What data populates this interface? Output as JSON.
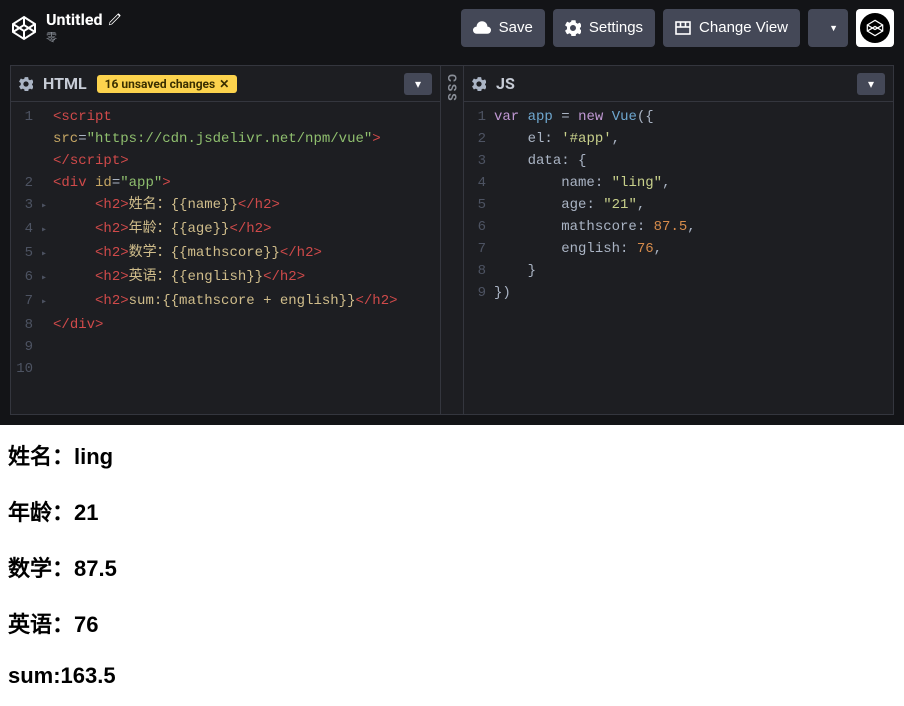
{
  "header": {
    "title": "Untitled",
    "author": "零",
    "save": "Save",
    "settings": "Settings",
    "change_view": "Change View"
  },
  "panes": {
    "html_title": "HTML",
    "js_title": "JS",
    "css_title": "CSS",
    "badge_text": "16 unsaved changes"
  },
  "html_code": [
    {
      "n": "1",
      "fold": "",
      "tokens": [
        [
          "<",
          "tag"
        ],
        [
          "script",
          "tag"
        ]
      ]
    },
    {
      "n": "",
      "fold": "",
      "tokens": [
        [
          "src",
          "attr"
        ],
        [
          "=",
          "op"
        ],
        [
          "\"https://cdn.jsdelivr.net/npm/vue\"",
          "str"
        ],
        [
          ">",
          "tag"
        ]
      ]
    },
    {
      "n": "",
      "fold": "",
      "tokens": [
        [
          "</",
          "tag"
        ],
        [
          "script",
          "tag"
        ],
        [
          ">",
          "tag"
        ]
      ]
    },
    {
      "n": "2",
      "fold": "",
      "tokens": [
        [
          "<",
          "tag"
        ],
        [
          "div ",
          "tag"
        ],
        [
          "id",
          "attr"
        ],
        [
          "=",
          "op"
        ],
        [
          "\"app\"",
          "str"
        ],
        [
          ">",
          "tag"
        ]
      ]
    },
    {
      "n": "3",
      "fold": "▸",
      "tokens": [
        [
          "     ",
          ""
        ],
        [
          "<",
          "tag"
        ],
        [
          "h2",
          "tag"
        ],
        [
          ">",
          "tag"
        ],
        [
          "姓名：{{name}}",
          "txt"
        ],
        [
          "</",
          "tag"
        ],
        [
          "h2",
          "tag"
        ],
        [
          ">",
          "tag"
        ]
      ]
    },
    {
      "n": "4",
      "fold": "▸",
      "tokens": [
        [
          "     ",
          ""
        ],
        [
          "<",
          "tag"
        ],
        [
          "h2",
          "tag"
        ],
        [
          ">",
          "tag"
        ],
        [
          "年龄：{{age}}",
          "txt"
        ],
        [
          "</",
          "tag"
        ],
        [
          "h2",
          "tag"
        ],
        [
          ">",
          "tag"
        ]
      ]
    },
    {
      "n": "5",
      "fold": "▸",
      "tokens": [
        [
          "     ",
          ""
        ],
        [
          "<",
          "tag"
        ],
        [
          "h2",
          "tag"
        ],
        [
          ">",
          "tag"
        ],
        [
          "数学：{{mathscore}}",
          "txt"
        ],
        [
          "</",
          "tag"
        ],
        [
          "h2",
          "tag"
        ],
        [
          ">",
          "tag"
        ]
      ]
    },
    {
      "n": "6",
      "fold": "▸",
      "tokens": [
        [
          "     ",
          ""
        ],
        [
          "<",
          "tag"
        ],
        [
          "h2",
          "tag"
        ],
        [
          ">",
          "tag"
        ],
        [
          "英语：{{english}}",
          "txt"
        ],
        [
          "</",
          "tag"
        ],
        [
          "h2",
          "tag"
        ],
        [
          ">",
          "tag"
        ]
      ]
    },
    {
      "n": "7",
      "fold": "▸",
      "tokens": [
        [
          "     ",
          ""
        ],
        [
          "<",
          "tag"
        ],
        [
          "h2",
          "tag"
        ],
        [
          ">",
          "tag"
        ],
        [
          "sum:{{mathscore + english}}",
          "txt"
        ],
        [
          "</",
          "tag"
        ],
        [
          "h2",
          "tag"
        ],
        [
          ">",
          "tag"
        ]
      ]
    },
    {
      "n": "8",
      "fold": "",
      "tokens": [
        [
          "</",
          "tag"
        ],
        [
          "div",
          "tag"
        ],
        [
          ">",
          "tag"
        ]
      ]
    },
    {
      "n": "9",
      "fold": "",
      "tokens": [
        [
          "",
          ""
        ]
      ]
    },
    {
      "n": "10",
      "fold": "",
      "tokens": [
        [
          "",
          ""
        ]
      ]
    }
  ],
  "js_code": [
    {
      "n": "1",
      "tokens": [
        [
          "var",
          "kw"
        ],
        [
          " ",
          "op"
        ],
        [
          "app",
          "varname"
        ],
        [
          " = ",
          "op"
        ],
        [
          "new",
          "kw"
        ],
        [
          " ",
          "op"
        ],
        [
          "Vue",
          "varname"
        ],
        [
          "({",
          "op"
        ]
      ]
    },
    {
      "n": "2",
      "tokens": [
        [
          "    ",
          ""
        ],
        [
          "el",
          "prop"
        ],
        [
          ": ",
          "op"
        ],
        [
          "'#app'",
          "strjs"
        ],
        [
          ",",
          "op"
        ]
      ]
    },
    {
      "n": "3",
      "tokens": [
        [
          "    ",
          ""
        ],
        [
          "data",
          "prop"
        ],
        [
          ": {",
          "op"
        ]
      ]
    },
    {
      "n": "4",
      "tokens": [
        [
          "        ",
          ""
        ],
        [
          "name",
          "prop"
        ],
        [
          ": ",
          "op"
        ],
        [
          "\"ling\"",
          "strjs"
        ],
        [
          ",",
          "op"
        ]
      ]
    },
    {
      "n": "5",
      "tokens": [
        [
          "        ",
          ""
        ],
        [
          "age",
          "prop"
        ],
        [
          ": ",
          "op"
        ],
        [
          "\"21\"",
          "strjs"
        ],
        [
          ",",
          "op"
        ]
      ]
    },
    {
      "n": "6",
      "tokens": [
        [
          "        ",
          ""
        ],
        [
          "mathscore",
          "prop"
        ],
        [
          ": ",
          "op"
        ],
        [
          "87.5",
          "num"
        ],
        [
          ",",
          "op"
        ]
      ]
    },
    {
      "n": "7",
      "tokens": [
        [
          "        ",
          ""
        ],
        [
          "english",
          "prop"
        ],
        [
          ": ",
          "op"
        ],
        [
          "76",
          "num"
        ],
        [
          ",",
          "op"
        ]
      ]
    },
    {
      "n": "8",
      "tokens": [
        [
          "    }",
          "op"
        ]
      ]
    },
    {
      "n": "9",
      "tokens": [
        [
          "})",
          "op"
        ]
      ]
    }
  ],
  "preview": {
    "line1": "姓名：ling",
    "line2": "年龄：21",
    "line3": "数学：87.5",
    "line4": "英语：76",
    "line5": "sum:163.5"
  }
}
